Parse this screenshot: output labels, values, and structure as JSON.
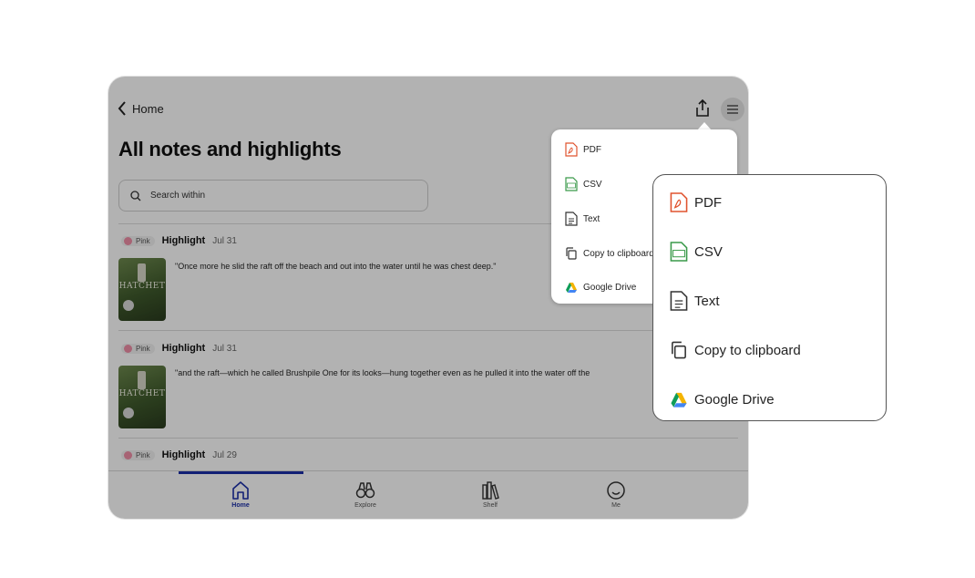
{
  "nav": {
    "back_label": "Home"
  },
  "page": {
    "title": "All notes and highlights"
  },
  "search": {
    "placeholder": "Search within"
  },
  "notes": [
    {
      "color": "Pink",
      "type": "Highlight",
      "date": "Jul 31",
      "text": "\"Once more he slid the raft off the beach and out into the water until he was chest deep.\"",
      "cover": "HATCHET"
    },
    {
      "color": "Pink",
      "type": "Highlight",
      "date": "Jul 31",
      "text": "\"and the raft—which he called Brushpile One for its looks—hung together even as he pulled it into the water off the",
      "cover": "HATCHET"
    },
    {
      "color": "Pink",
      "type": "Highlight",
      "date": "Jul 29"
    }
  ],
  "export_menu": {
    "items": [
      {
        "label": "PDF",
        "icon": "pdf-file-icon"
      },
      {
        "label": "CSV",
        "icon": "csv-file-icon"
      },
      {
        "label": "Text",
        "icon": "text-file-icon"
      },
      {
        "label": "Copy to clipboard",
        "icon": "copy-icon"
      },
      {
        "label": "Google Drive",
        "icon": "google-drive-icon"
      }
    ]
  },
  "tabs": [
    {
      "label": "Home",
      "icon": "home-icon",
      "active": true
    },
    {
      "label": "Explore",
      "icon": "binoculars-icon"
    },
    {
      "label": "Shelf",
      "icon": "books-icon"
    },
    {
      "label": "Me",
      "icon": "smiley-icon"
    }
  ],
  "colors": {
    "accent": "#1a2fa8",
    "pdf": "#e0532f",
    "csv": "#3a9a4a",
    "highlight_pink": "#f08ea6"
  }
}
